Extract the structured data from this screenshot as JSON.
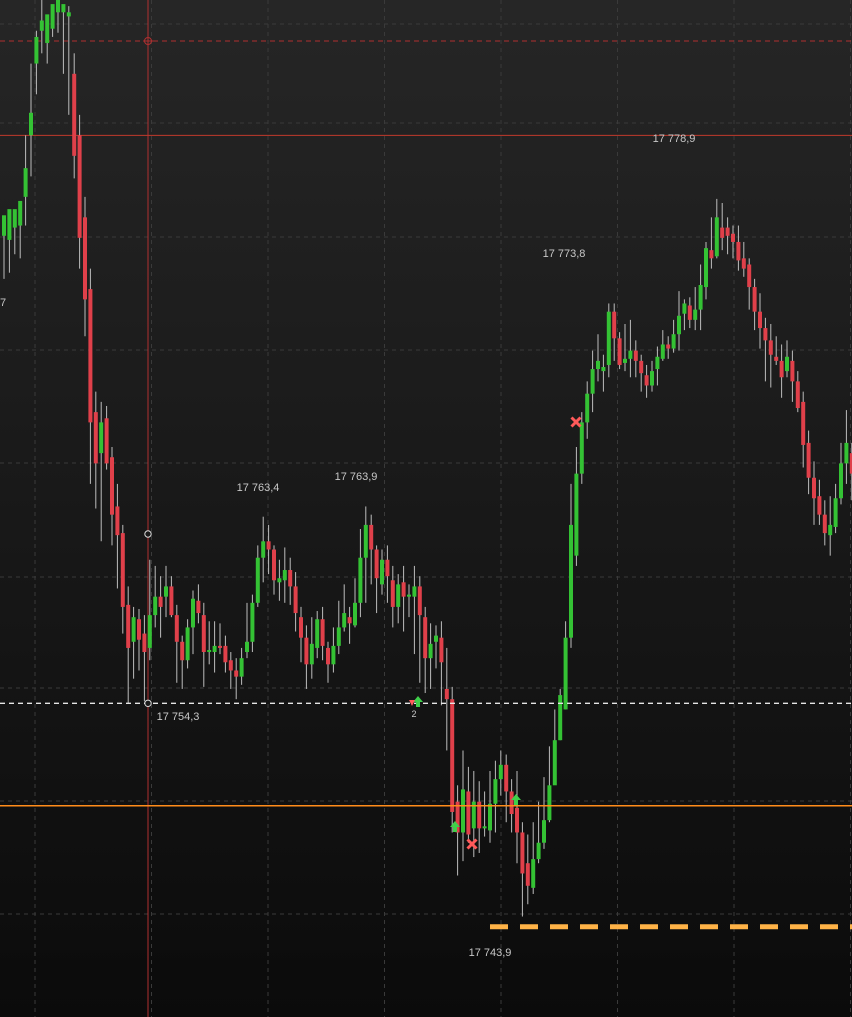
{
  "chart_data": {
    "type": "candlestick",
    "price_range": [
      17739.0,
      17788.6
    ],
    "colors": {
      "up": "#34c234",
      "down": "#e0404a",
      "wick": "#bdbdbd",
      "grid": "#3a3a3a",
      "crosshair": "#b03030",
      "resistance_line": "#c0392b",
      "support_line": "#ff8c1a",
      "dashed_level": "#e6e6e6",
      "target_line": "#ffb347",
      "background_top": "#262626",
      "background_bottom": "#0b0b0b"
    },
    "candles": [
      [
        17777.1,
        17778.1,
        17775.0,
        17777.2
      ],
      [
        17776.9,
        17778.4,
        17775.3,
        17777.5
      ],
      [
        17777.5,
        17778.4,
        17776.2,
        17777.8
      ],
      [
        17777.6,
        17778.8,
        17776.0,
        17777.9
      ],
      [
        17779.0,
        17780.4,
        17777.6,
        17782.0
      ],
      [
        17782.0,
        17783.1,
        17780.0,
        17785.5
      ],
      [
        17785.5,
        17786.8,
        17784.0,
        17787.1
      ],
      [
        17787.1,
        17787.6,
        17786.0,
        17788.6
      ],
      [
        17786.5,
        17787.9,
        17785.5,
        17787.2
      ],
      [
        17787.2,
        17788.4,
        17786.8,
        17788.0
      ],
      [
        17788.0,
        17789.1,
        17787.0,
        17788.3
      ],
      [
        17788.0,
        17788.4,
        17785.0,
        17788.3
      ],
      [
        17787.8,
        17788.0,
        17783.0,
        17788.3
      ],
      [
        17785.0,
        17781.0,
        17779.9,
        17786.0
      ],
      [
        17782.0,
        17777.0,
        17775.5,
        17783.0
      ],
      [
        17778.0,
        17774.0,
        17772.2,
        17779.0
      ],
      [
        17774.5,
        17768.0,
        17765.0,
        17775.5
      ],
      [
        17768.5,
        17766.0,
        17763.8,
        17769.5
      ],
      [
        17766.5,
        17768.0,
        17762.2,
        17769.0
      ],
      [
        17768.2,
        17766.0,
        17765.7,
        17768.8
      ],
      [
        17766.3,
        17763.5,
        17762.0,
        17766.8
      ],
      [
        17763.9,
        17762.5,
        17759.9,
        17765.0
      ],
      [
        17762.6,
        17759.0,
        17757.7,
        17763.0
      ],
      [
        17759.1,
        17757.0,
        17754.3,
        17760.0
      ],
      [
        17757.3,
        17758.5,
        17755.5,
        17759.0
      ],
      [
        17758.4,
        17757.4,
        17755.9,
        17758.9
      ],
      [
        17757.7,
        17756.8,
        17754.4,
        17758.6
      ],
      [
        17757.0,
        17758.6,
        17756.4,
        17761.3
      ],
      [
        17758.6,
        17759.5,
        17758.0,
        17761.0
      ],
      [
        17759.5,
        17759.0,
        17757.5,
        17760.5
      ],
      [
        17759.5,
        17760.0,
        17758.5,
        17761.0
      ],
      [
        17760.0,
        17758.6,
        17758.5,
        17760.5
      ],
      [
        17758.6,
        17757.3,
        17755.3,
        17759.1
      ],
      [
        17757.3,
        17756.4,
        17755.0,
        17757.6
      ],
      [
        17756.4,
        17758.0,
        17756.0,
        17758.4
      ],
      [
        17758.0,
        17759.4,
        17756.7,
        17759.8
      ],
      [
        17759.3,
        17758.7,
        17758.2,
        17760.1
      ],
      [
        17758.6,
        17756.8,
        17755.1,
        17759.2
      ],
      [
        17756.8,
        17756.9,
        17756.2,
        17758.3
      ],
      [
        17756.8,
        17757.1,
        17755.8,
        17758.3
      ],
      [
        17757.1,
        17757.0,
        17756.7,
        17758.2
      ],
      [
        17757.1,
        17756.3,
        17755.8,
        17757.6
      ],
      [
        17756.4,
        17755.9,
        17755.0,
        17756.8
      ],
      [
        17755.9,
        17755.6,
        17754.5,
        17756.5
      ],
      [
        17755.6,
        17756.5,
        17755.2,
        17757.0
      ],
      [
        17756.8,
        17757.3,
        17756.5,
        17759.2
      ],
      [
        17757.3,
        17759.2,
        17756.8,
        17759.6
      ],
      [
        17759.2,
        17761.4,
        17759.0,
        17762.0
      ],
      [
        17761.4,
        17762.2,
        17760.2,
        17763.4
      ],
      [
        17762.2,
        17761.8,
        17760.6,
        17763.0
      ],
      [
        17761.8,
        17760.3,
        17759.6,
        17762.0
      ],
      [
        17760.2,
        17760.4,
        17759.3,
        17761.3
      ],
      [
        17760.3,
        17760.8,
        17759.2,
        17761.9
      ],
      [
        17760.8,
        17760.0,
        17759.1,
        17761.4
      ],
      [
        17760.0,
        17758.7,
        17757.8,
        17760.7
      ],
      [
        17758.5,
        17757.5,
        17756.3,
        17759.0
      ],
      [
        17757.5,
        17756.2,
        17755.0,
        17758.1
      ],
      [
        17756.2,
        17757.2,
        17755.5,
        17758.5
      ],
      [
        17757.0,
        17758.4,
        17756.5,
        17758.8
      ],
      [
        17758.4,
        17757.1,
        17756.4,
        17759.0
      ],
      [
        17757.0,
        17756.2,
        17755.3,
        17757.3
      ],
      [
        17756.2,
        17757.1,
        17755.8,
        17758.0
      ],
      [
        17757.1,
        17758.0,
        17756.7,
        17759.3
      ],
      [
        17758.0,
        17758.7,
        17757.8,
        17760.1
      ],
      [
        17758.5,
        17758.2,
        17757.2,
        17759.0
      ],
      [
        17758.1,
        17759.2,
        17758.0,
        17760.4
      ],
      [
        17759.2,
        17761.4,
        17758.5,
        17762.8
      ],
      [
        17761.4,
        17763.0,
        17759.2,
        17763.9
      ],
      [
        17763.0,
        17761.8,
        17760.1,
        17763.5
      ],
      [
        17761.8,
        17760.4,
        17758.7,
        17762.0
      ],
      [
        17760.1,
        17761.3,
        17759.6,
        17761.8
      ],
      [
        17761.3,
        17760.5,
        17759.2,
        17762.0
      ],
      [
        17760.3,
        17759.0,
        17758.0,
        17761.0
      ],
      [
        17759.0,
        17760.1,
        17758.2,
        17760.6
      ],
      [
        17760.2,
        17759.5,
        17757.8,
        17761.0
      ],
      [
        17759.5,
        17759.6,
        17758.5,
        17760.1
      ],
      [
        17759.5,
        17760.0,
        17756.7,
        17761.0
      ],
      [
        17760.0,
        17758.6,
        17755.3,
        17760.5
      ],
      [
        17758.5,
        17756.5,
        17754.8,
        17759.0
      ],
      [
        17756.5,
        17757.2,
        17755.0,
        17758.2
      ],
      [
        17757.3,
        17757.6,
        17756.0,
        17758.1
      ],
      [
        17757.5,
        17756.3,
        17754.2,
        17758.3
      ],
      [
        17755.0,
        17754.5,
        17752.0,
        17757.0
      ],
      [
        17754.5,
        17749.0,
        17748.0,
        17755.1
      ],
      [
        17749.5,
        17748.0,
        17745.9,
        17750.3
      ],
      [
        17748.0,
        17750.1,
        17746.6,
        17752.0
      ],
      [
        17750.0,
        17747.9,
        17747.5,
        17751.2
      ],
      [
        17748.2,
        17749.5,
        17746.8,
        17751.0
      ],
      [
        17749.5,
        17748.2,
        17747.0,
        17750.5
      ],
      [
        17748.2,
        17748.3,
        17747.8,
        17750.0
      ],
      [
        17748.1,
        17749.4,
        17747.5,
        17751.0
      ],
      [
        17749.4,
        17750.6,
        17748.0,
        17751.5
      ],
      [
        17750.6,
        17751.3,
        17749.8,
        17752.0
      ],
      [
        17751.3,
        17750.0,
        17748.5,
        17751.8
      ],
      [
        17750.0,
        17748.9,
        17748.0,
        17750.6
      ],
      [
        17749.2,
        17748.0,
        17746.5,
        17751.0
      ],
      [
        17748.0,
        17746.0,
        17743.9,
        17748.5
      ],
      [
        17746.5,
        17745.4,
        17744.5,
        17747.9
      ],
      [
        17745.3,
        17746.7,
        17745.0,
        17748.5
      ],
      [
        17746.7,
        17747.5,
        17746.5,
        17749.5
      ],
      [
        17747.5,
        17748.6,
        17747.2,
        17750.7
      ],
      [
        17748.6,
        17750.3,
        17748.5,
        17752.2
      ],
      [
        17750.3,
        17752.5,
        17750.5,
        17754.0
      ],
      [
        17752.5,
        17754.7,
        17752.5,
        17755.0
      ],
      [
        17754.0,
        17757.5,
        17754.0,
        17758.3
      ],
      [
        17757.5,
        17763.0,
        17757.0,
        17765.0
      ],
      [
        17761.5,
        17765.5,
        17761.0,
        17766.8
      ],
      [
        17765.5,
        17768.0,
        17765.0,
        17768.5
      ],
      [
        17768.0,
        17769.4,
        17767.2,
        17770.0
      ],
      [
        17769.4,
        17770.6,
        17768.5,
        17771.5
      ],
      [
        17770.6,
        17771.0,
        17770.0,
        17772.3
      ],
      [
        17770.5,
        17770.7,
        17769.5,
        17771.3
      ],
      [
        17770.8,
        17773.4,
        17770.2,
        17773.8
      ],
      [
        17773.4,
        17772.1,
        17771.0,
        17773.8
      ],
      [
        17772.1,
        17770.8,
        17770.6,
        17772.4
      ],
      [
        17770.9,
        17771.1,
        17770.5,
        17772.8
      ],
      [
        17771.1,
        17771.5,
        17770.2,
        17773.0
      ],
      [
        17771.5,
        17771.0,
        17770.2,
        17772.0
      ],
      [
        17771.0,
        17770.4,
        17769.5,
        17771.3
      ],
      [
        17770.3,
        17769.8,
        17769.2,
        17770.8
      ],
      [
        17769.8,
        17770.5,
        17769.5,
        17771.0
      ],
      [
        17770.6,
        17771.2,
        17769.8,
        17771.7
      ],
      [
        17771.1,
        17771.8,
        17771.0,
        17772.5
      ],
      [
        17771.8,
        17771.6,
        17771.1,
        17772.2
      ],
      [
        17771.6,
        17772.3,
        17771.4,
        17773.0
      ],
      [
        17772.3,
        17773.2,
        17771.5,
        17774.4
      ],
      [
        17773.3,
        17773.8,
        17772.5,
        17774.0
      ],
      [
        17773.7,
        17773.0,
        17772.6,
        17774.1
      ],
      [
        17773.0,
        17773.5,
        17772.5,
        17774.6
      ],
      [
        17773.5,
        17774.7,
        17772.5,
        17775.7
      ],
      [
        17774.6,
        17776.5,
        17774.0,
        17776.8
      ],
      [
        17776.4,
        17776.0,
        17775.5,
        17778.0
      ],
      [
        17776.1,
        17778.0,
        17776.0,
        17778.9
      ],
      [
        17777.5,
        17777.0,
        17776.4,
        17778.7
      ],
      [
        17777.5,
        17777.1,
        17776.2,
        17778.0
      ],
      [
        17777.2,
        17776.8,
        17776.0,
        17777.6
      ],
      [
        17776.8,
        17775.9,
        17775.4,
        17777.6
      ],
      [
        17776.0,
        17775.5,
        17775.1,
        17776.8
      ],
      [
        17775.7,
        17774.6,
        17773.5,
        17776.0
      ],
      [
        17774.6,
        17773.4,
        17772.5,
        17775.0
      ],
      [
        17773.4,
        17772.6,
        17771.6,
        17774.3
      ],
      [
        17772.6,
        17772.0,
        17770.0,
        17773.1
      ],
      [
        17772.0,
        17771.3,
        17769.7,
        17772.8
      ],
      [
        17771.2,
        17771.0,
        17770.8,
        17772.2
      ],
      [
        17771.0,
        17770.2,
        17769.2,
        17771.8
      ],
      [
        17770.5,
        17771.2,
        17770.2,
        17772.0
      ],
      [
        17771.0,
        17770.0,
        17769.0,
        17771.5
      ],
      [
        17770.0,
        17768.7,
        17768.5,
        17770.5
      ],
      [
        17769.0,
        17766.9,
        17765.8,
        17769.5
      ],
      [
        17767.0,
        17765.3,
        17764.5,
        17767.6
      ],
      [
        17765.3,
        17764.3,
        17763.0,
        17766.1
      ],
      [
        17764.4,
        17763.5,
        17763.0,
        17765.2
      ],
      [
        17763.5,
        17762.6,
        17762.0,
        17764.2
      ],
      [
        17762.5,
        17763.0,
        17761.5,
        17764.4
      ],
      [
        17762.9,
        17764.3,
        17762.6,
        17765.0
      ],
      [
        17764.3,
        17766.0,
        17764.0,
        17767.0
      ],
      [
        17766.0,
        17767.0,
        17765.0,
        17768.6
      ],
      [
        17766.5,
        17765.5,
        17764.2,
        17767.0
      ],
      [
        17765.5,
        17764.0,
        17763.8,
        17766.0
      ]
    ],
    "annotations": [
      {
        "id": "high-1",
        "text": "17 763,4"
      },
      {
        "id": "high-2",
        "text": "17 763,9"
      },
      {
        "id": "high-3",
        "text": "17 773,8"
      },
      {
        "id": "high-4",
        "text": "17 778,9"
      },
      {
        "id": "low-1",
        "text": "17 754,3"
      },
      {
        "id": "low-2",
        "text": "17 743,9"
      },
      {
        "id": "edge-digit",
        "text": "7"
      },
      {
        "id": "marker-count",
        "text": "2"
      }
    ],
    "levels": {
      "resistance": 17782.0,
      "dashed": 17754.3,
      "support": 17749.3,
      "target": 17743.4,
      "crosshair_price": 17786.6
    },
    "grid": true
  }
}
